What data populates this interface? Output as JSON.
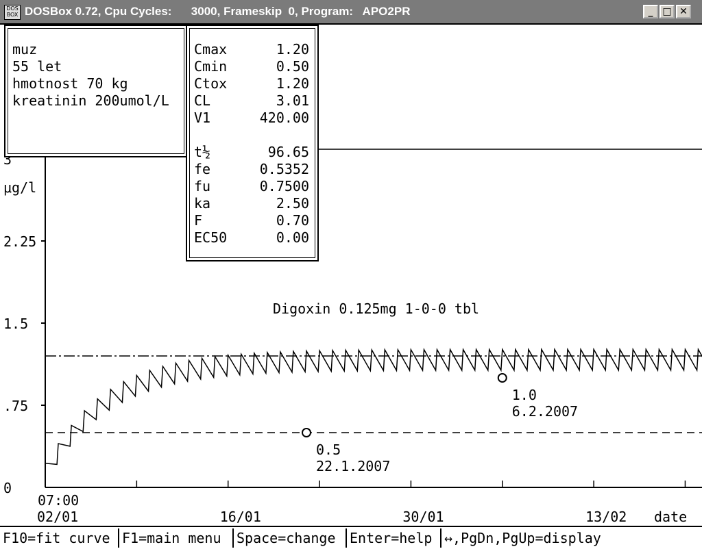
{
  "window": {
    "title": "DOSBox 0.72, Cpu Cycles:      3000, Frameskip  0, Program:   APO2PR",
    "icon_label": "DOS BOX",
    "buttons": [
      "minimize",
      "maximize",
      "close"
    ]
  },
  "patient": {
    "lines": [
      "muz",
      "55 let",
      "hmotnost 70 kg",
      "kreatinin 200umol/L"
    ]
  },
  "params": {
    "group1": [
      {
        "name": "Cmax",
        "value": "1.20"
      },
      {
        "name": "Cmin",
        "value": "0.50"
      },
      {
        "name": "Ctox",
        "value": "1.20"
      },
      {
        "name": "CL",
        "value": "3.01"
      },
      {
        "name": "V1",
        "value": "420.00"
      }
    ],
    "group2": [
      {
        "name": "t½",
        "value": "96.65"
      },
      {
        "name": "fe",
        "value": "0.5352"
      },
      {
        "name": "fu",
        "value": "0.7500"
      },
      {
        "name": "ka",
        "value": "2.50"
      },
      {
        "name": "F",
        "value": "0.70"
      },
      {
        "name": "EC50",
        "value": "0.00"
      }
    ]
  },
  "chart_data": {
    "type": "line",
    "title": "Digoxin 0.125mg 1-0-0 tbl",
    "ylabel": "μg/l",
    "xlabel": "date",
    "ylim": [
      0,
      3
    ],
    "yticks": [
      {
        "value": 0,
        "label": "0"
      },
      {
        "value": 0.75,
        "label": ".75"
      },
      {
        "value": 1.5,
        "label": "1.5"
      },
      {
        "value": 2.25,
        "label": "2.25"
      },
      {
        "value": 3,
        "label": "3"
      }
    ],
    "xlim": [
      0,
      36
    ],
    "x_start_label": "07:00",
    "xticks": [
      {
        "day": 0,
        "label": "02/01"
      },
      {
        "day": 14,
        "label": "16/01"
      },
      {
        "day": 28,
        "label": "30/01"
      },
      {
        "day": 42,
        "label": "13/02"
      }
    ],
    "grid": false,
    "reference_lines": [
      {
        "name": "Cmax",
        "value": 1.2,
        "style": "dash-dot"
      },
      {
        "name": "Cmin",
        "value": 0.5,
        "style": "dashed"
      }
    ],
    "series": [
      {
        "type": "dosing-profile",
        "dose_interval_days": 1,
        "trough_start": 0.21,
        "steady_trough": 1.07,
        "steady_peak": 1.26,
        "accumulation_days": 14
      }
    ],
    "measurements": [
      {
        "date": "22.1.2007",
        "value": 0.5,
        "label": "0.5"
      },
      {
        "date": "6.2.2007",
        "value": 1.0,
        "label": "1.0"
      }
    ]
  },
  "statusbar": {
    "items": [
      "F10=fit curve",
      "F1=main menu",
      "Space=change",
      "Enter=help",
      "↔,PgDn,PgUp=display"
    ]
  }
}
